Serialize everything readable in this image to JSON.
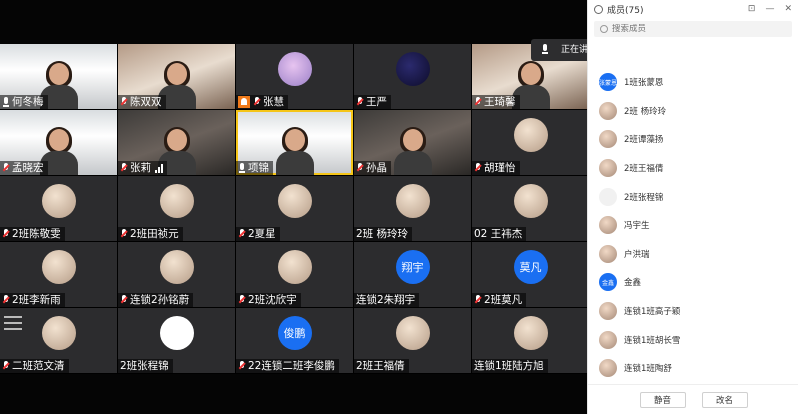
{
  "speaking_banner": {
    "label": "正在讲话: 项锦;"
  },
  "tiles": [
    {
      "name": "何冬梅",
      "kind": "video",
      "style": "room",
      "mic": "on"
    },
    {
      "name": "陈双双",
      "kind": "video",
      "style": "warm",
      "mic": "muted"
    },
    {
      "name": "张慧",
      "kind": "avatar",
      "avatar": "purple",
      "mic": "muted",
      "host": true
    },
    {
      "name": "王严",
      "kind": "avatar",
      "avatar": "navy",
      "mic": "muted"
    },
    {
      "name": "王琦馨",
      "kind": "video",
      "style": "warm",
      "mic": "muted"
    },
    {
      "name": "孟晓宏",
      "kind": "video",
      "style": "room",
      "mic": "muted"
    },
    {
      "name": "张莉",
      "kind": "video",
      "style": "dim",
      "mic": "muted",
      "signal": true
    },
    {
      "name": "项锦",
      "kind": "video",
      "style": "room",
      "mic": "on",
      "active": true
    },
    {
      "name": "孙晶",
      "kind": "video",
      "style": "dim",
      "mic": "muted"
    },
    {
      "name": "胡瑾怡",
      "kind": "avatar",
      "avatar": "default",
      "mic": "muted"
    },
    {
      "name": "2班陈敬雯",
      "kind": "avatar",
      "avatar": "default",
      "mic": "muted"
    },
    {
      "name": "2班田祯元",
      "kind": "avatar",
      "avatar": "default",
      "mic": "muted"
    },
    {
      "name": "2夏星",
      "kind": "avatar",
      "avatar": "default",
      "mic": "muted"
    },
    {
      "name": "2班  杨玲玲",
      "kind": "avatar",
      "avatar": "default",
      "mic": "none"
    },
    {
      "name": "02   王祎杰",
      "kind": "avatar",
      "avatar": "default",
      "mic": "none"
    },
    {
      "name": "2班李新雨",
      "kind": "avatar",
      "avatar": "default",
      "mic": "muted"
    },
    {
      "name": "连锁2孙铭蔚",
      "kind": "avatar",
      "avatar": "default",
      "mic": "muted"
    },
    {
      "name": "2班沈欣宇",
      "kind": "avatar",
      "avatar": "default",
      "mic": "muted"
    },
    {
      "name": "连锁2朱翔宇",
      "kind": "avatar",
      "avatar": "blue",
      "avatar_text": "翔宇",
      "mic": "none"
    },
    {
      "name": "2班莫凡",
      "kind": "avatar",
      "avatar": "blue",
      "avatar_text": "莫凡",
      "mic": "muted"
    },
    {
      "name": "二班范文清",
      "kind": "avatar",
      "avatar": "default",
      "mic": "muted",
      "menu": true
    },
    {
      "name": "2班张程锦",
      "kind": "avatar",
      "avatar": "white",
      "mic": "none"
    },
    {
      "name": "22连锁二班李俊鹏",
      "kind": "avatar",
      "avatar": "blue",
      "avatar_text": "俊鹏",
      "mic": "muted"
    },
    {
      "name": "2班王福倩",
      "kind": "avatar",
      "avatar": "default",
      "mic": "none"
    },
    {
      "name": "连锁1班陆方旭",
      "kind": "avatar",
      "avatar": "default",
      "mic": "none"
    }
  ],
  "panel": {
    "title": "成员(75)",
    "controls": [
      "⊡",
      "—",
      "✕"
    ],
    "search_placeholder": "搜索成员",
    "members": [
      {
        "name": "1班张蒙恩",
        "avatar": "blue",
        "avatar_text": "张蒙恩"
      },
      {
        "name": "2班  杨玲玲",
        "avatar": "default"
      },
      {
        "name": "2班谭藻扬",
        "avatar": "default"
      },
      {
        "name": "2班王福倩",
        "avatar": "default"
      },
      {
        "name": "2班张程锦",
        "avatar": "light"
      },
      {
        "name": "冯宇生",
        "avatar": "default"
      },
      {
        "name": "户洪瑞",
        "avatar": "default"
      },
      {
        "name": "金鑫",
        "avatar": "blue",
        "avatar_text": "金鑫"
      },
      {
        "name": "连锁1班高子颖",
        "avatar": "default"
      },
      {
        "name": "连锁1班胡长雪",
        "avatar": "default"
      },
      {
        "name": "连锁1班陶舒",
        "avatar": "default"
      }
    ],
    "mute_all": "静音",
    "rename": "改名"
  }
}
